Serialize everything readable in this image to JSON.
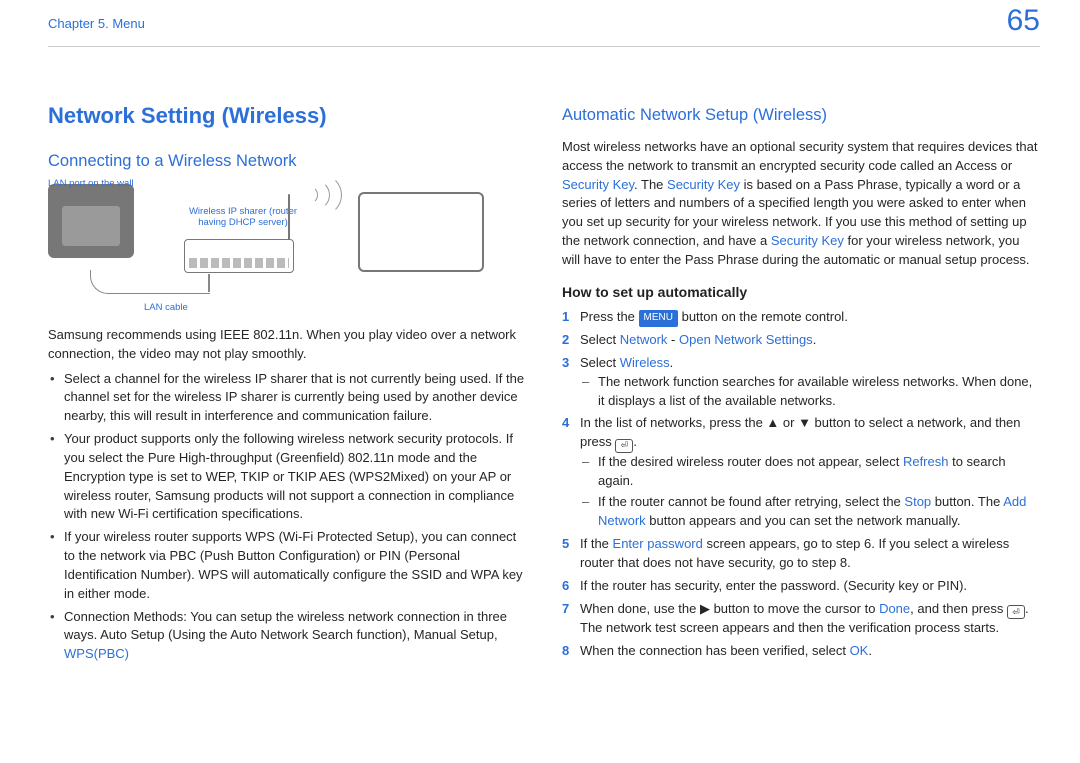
{
  "header": {
    "chapter": "Chapter 5. Menu",
    "page_number": "65"
  },
  "left": {
    "h1": "Network Setting (Wireless)",
    "h2": "Connecting to a Wireless Network",
    "diagram": {
      "lan_port_label": "LAN port on the wall",
      "sharer_label": "Wireless IP sharer (router having DHCP server)",
      "lan_cable_label": "LAN cable"
    },
    "p1": "Samsung recommends using IEEE 802.11n. When you play video over a network connection, the video may not play smoothly.",
    "bullets": [
      "Select a channel for the wireless IP sharer that is not currently being used. If the channel set for the wireless IP sharer is currently being used by another device nearby, this will result in interference and communication failure.",
      "Your product supports only the following wireless network security protocols. If you select the Pure High-throughput (Greenfield) 802.11n mode and the Encryption type is set to WEP, TKIP or TKIP AES (WPS2Mixed) on your AP or wireless router, Samsung products will not support a connection in compliance with new Wi-Fi certification specifications.",
      "If your wireless router supports WPS (Wi-Fi Protected Setup), you can connect to the network via PBC (Push Button Configuration) or PIN (Personal Identification Number). WPS will automatically configure the SSID and WPA key in either mode."
    ],
    "bullet4_pre": "Connection Methods: You can setup the wireless network connection in three ways. Auto Setup (Using the Auto Network Search function), Manual Setup, ",
    "bullet4_link": "WPS(PBC)"
  },
  "right": {
    "h2": "Automatic Network Setup (Wireless)",
    "intro": {
      "p1a": "Most wireless networks have an optional security system that requires devices that access the network to transmit an encrypted security code called an Access or ",
      "term1": "Security Key",
      "p1b": ". The ",
      "term2": "Security Key",
      "p1c": " is based on a Pass Phrase, typically a word or a series of letters and numbers of a specified length you were asked to enter when you set up security for your wireless network. If you use this method of setting up the network connection, and have a ",
      "term3": "Security Key",
      "p1d": " for your wireless network, you will have to enter the Pass Phrase during the automatic or manual setup process."
    },
    "howto_h": "How to set up automatically",
    "steps": {
      "s1": {
        "pre": "Press the ",
        "menu": "MENU",
        "post": " button on the remote control."
      },
      "s2": {
        "pre": "Select ",
        "network": "Network",
        "dash": " - ",
        "open": "Open Network Settings",
        "post": "."
      },
      "s3": {
        "pre": "Select ",
        "wireless": "Wireless",
        "post": "."
      },
      "s3_sub": "The network function searches for available wireless networks. When done, it displays a list of the available networks.",
      "s4": {
        "pre": "In the list of networks, press the ▲ or ▼ button to select a network, and then press ",
        "post": "."
      },
      "s4_sub1": {
        "pre": "If the desired wireless router does not appear, select ",
        "refresh": "Refresh",
        "post": " to search again."
      },
      "s4_sub2": {
        "pre": "If the router cannot be found after retrying, select the ",
        "stop": "Stop",
        "mid": " button. The ",
        "add": "Add Network",
        "post": " button appears and you can set the network manually."
      },
      "s5": {
        "pre": "If the ",
        "enter": "Enter password",
        "post": " screen appears, go to step 6. If you select a wireless router that does not have security, go to step 8."
      },
      "s6": "If the router has security, enter the password. (Security key or PIN).",
      "s7": {
        "pre": "When done, use the ▶ button to move the cursor to ",
        "done": "Done",
        "mid": ", and then press ",
        "post": ". The network test screen appears and then the verification process starts."
      },
      "s8": {
        "pre": "When the connection has been verified, select ",
        "ok": "OK",
        "post": "."
      }
    }
  }
}
